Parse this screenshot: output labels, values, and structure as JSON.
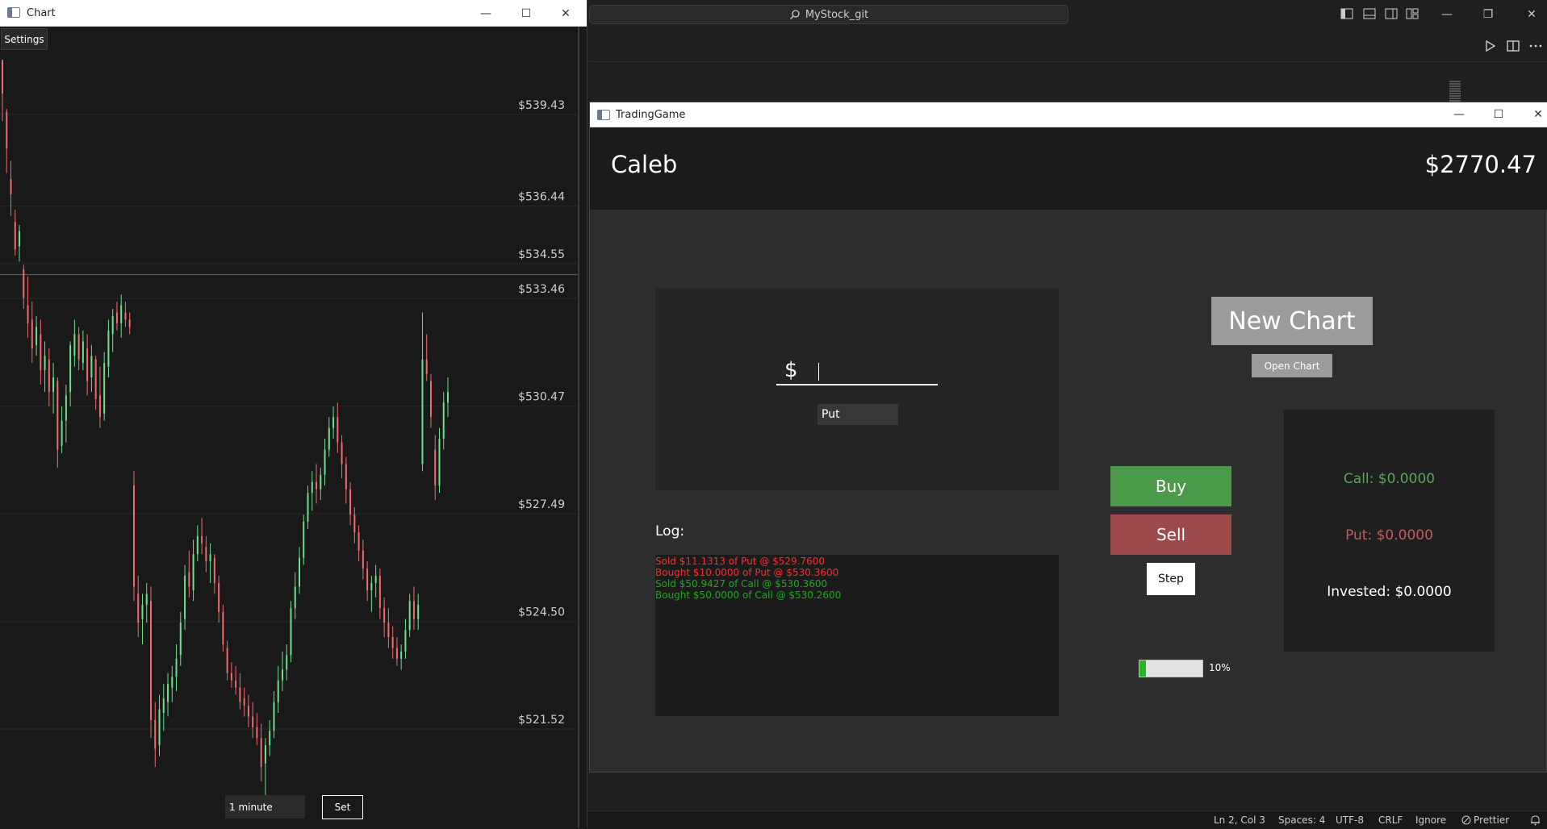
{
  "vscode": {
    "search": "MyStock_git",
    "status_bar": {
      "position": "Ln 2, Col 3",
      "spaces": "Spaces: 4",
      "encoding": "UTF-8",
      "eol": "CRLF",
      "ignore": "Ignore",
      "prettier": "Prettier"
    }
  },
  "chart_window": {
    "title": "Chart",
    "settings_label": "Settings",
    "interval_value": "1 minute",
    "set_label": "Set",
    "price_labels": [
      "$539.43",
      "$536.44",
      "$534.55",
      "$533.46",
      "$530.47",
      "$527.49",
      "$524.50",
      "$521.52"
    ]
  },
  "chart_data": {
    "type": "candlestick",
    "title": "",
    "ytick_labels": [
      "$539.43",
      "$536.44",
      "$534.55",
      "$533.46",
      "$530.47",
      "$527.49",
      "$524.50",
      "$521.52"
    ],
    "ylim": [
      519.0,
      541.0
    ],
    "current_price_line": 534.12,
    "colors": {
      "up": "#6fe08a",
      "down": "#f06b6b"
    },
    "candles": [
      [
        540.9,
        540.4,
        538.9,
        539.8
      ],
      [
        539.2,
        539.3,
        537.2,
        538.0
      ],
      [
        537.0,
        537.6,
        535.8,
        536.5
      ],
      [
        535.6,
        536.0,
        534.5,
        534.7
      ],
      [
        534.8,
        535.5,
        534.3,
        535.3
      ],
      [
        534.0,
        534.2,
        532.9,
        533.2
      ],
      [
        533.0,
        533.8,
        532.1,
        532.5
      ],
      [
        532.6,
        533.1,
        531.4,
        531.8
      ],
      [
        531.9,
        532.7,
        531.6,
        532.4
      ],
      [
        532.2,
        532.6,
        530.8,
        531.2
      ],
      [
        531.2,
        532.0,
        530.6,
        531.6
      ],
      [
        531.5,
        531.8,
        530.2,
        530.6
      ],
      [
        530.6,
        531.4,
        530.0,
        531.0
      ],
      [
        530.9,
        531.0,
        528.5,
        529.0
      ],
      [
        529.1,
        530.2,
        528.9,
        529.8
      ],
      [
        529.8,
        530.8,
        529.2,
        530.5
      ],
      [
        530.6,
        532.0,
        530.2,
        531.9
      ],
      [
        531.6,
        532.6,
        531.3,
        532.2
      ],
      [
        532.2,
        532.4,
        531.2,
        531.5
      ],
      [
        531.4,
        532.3,
        531.2,
        532.0
      ],
      [
        531.8,
        532.2,
        530.5,
        530.9
      ],
      [
        531.0,
        531.9,
        530.6,
        531.6
      ],
      [
        531.5,
        531.6,
        530.1,
        530.4
      ],
      [
        530.5,
        531.3,
        529.6,
        529.9
      ],
      [
        530.0,
        531.7,
        529.8,
        531.4
      ],
      [
        531.3,
        532.6,
        531.0,
        532.3
      ],
      [
        532.2,
        532.9,
        531.7,
        532.7
      ],
      [
        532.8,
        533.1,
        532.3,
        532.5
      ],
      [
        532.5,
        533.3,
        532.1,
        533.0
      ],
      [
        532.8,
        533.1,
        532.4,
        532.6
      ],
      [
        532.6,
        532.8,
        532.2,
        532.4
      ],
      [
        528.0,
        528.4,
        524.8,
        525.2
      ],
      [
        525.0,
        525.5,
        523.8,
        524.2
      ],
      [
        524.3,
        525.0,
        523.6,
        524.7
      ],
      [
        524.7,
        525.3,
        524.2,
        525.0
      ],
      [
        524.8,
        525.2,
        521.0,
        521.5
      ],
      [
        521.5,
        522.0,
        520.2,
        520.7
      ],
      [
        520.8,
        522.2,
        520.5,
        521.8
      ],
      [
        521.7,
        522.5,
        521.2,
        522.1
      ],
      [
        522.0,
        522.8,
        521.6,
        522.5
      ],
      [
        522.4,
        523.0,
        522.0,
        522.7
      ],
      [
        522.7,
        523.6,
        522.3,
        523.2
      ],
      [
        523.3,
        524.5,
        523.0,
        524.2
      ],
      [
        524.3,
        525.8,
        524.0,
        525.5
      ],
      [
        525.6,
        526.2,
        524.9,
        525.2
      ],
      [
        525.1,
        526.5,
        524.8,
        526.1
      ],
      [
        526.1,
        526.9,
        525.9,
        526.6
      ],
      [
        526.6,
        527.1,
        526.1,
        526.4
      ],
      [
        526.3,
        526.6,
        525.6,
        525.9
      ],
      [
        525.9,
        526.4,
        525.3,
        526.1
      ],
      [
        526.0,
        526.1,
        525.0,
        525.3
      ],
      [
        525.3,
        525.5,
        524.2,
        524.5
      ],
      [
        524.5,
        524.7,
        523.4,
        523.6
      ],
      [
        523.5,
        523.7,
        522.6,
        522.8
      ],
      [
        522.8,
        523.1,
        522.4,
        522.6
      ],
      [
        522.6,
        523.0,
        522.2,
        522.4
      ],
      [
        522.4,
        522.8,
        521.8,
        522.0
      ],
      [
        522.1,
        522.4,
        521.6,
        521.9
      ],
      [
        521.9,
        522.2,
        521.3,
        521.6
      ],
      [
        521.6,
        522.0,
        521.0,
        521.3
      ],
      [
        521.3,
        521.7,
        520.8,
        521.0
      ],
      [
        521.0,
        521.4,
        519.8,
        520.2
      ],
      [
        520.3,
        521.0,
        519.3,
        520.8
      ],
      [
        520.8,
        521.5,
        520.5,
        521.2
      ],
      [
        521.2,
        522.3,
        521.0,
        522.0
      ],
      [
        522.0,
        523.0,
        521.7,
        522.6
      ],
      [
        522.6,
        523.4,
        522.3,
        522.9
      ],
      [
        522.9,
        523.6,
        522.6,
        523.3
      ],
      [
        523.3,
        524.8,
        523.1,
        524.6
      ],
      [
        524.6,
        525.6,
        524.3,
        525.2
      ],
      [
        525.2,
        526.3,
        525.0,
        526.0
      ],
      [
        526.0,
        527.2,
        525.8,
        527.0
      ],
      [
        527.0,
        528.0,
        526.8,
        527.8
      ],
      [
        527.8,
        528.4,
        527.3,
        528.1
      ],
      [
        528.1,
        528.6,
        527.5,
        527.9
      ],
      [
        527.9,
        528.5,
        527.6,
        528.3
      ],
      [
        528.3,
        529.3,
        528.0,
        529.0
      ],
      [
        529.0,
        529.9,
        528.8,
        529.6
      ],
      [
        529.6,
        530.2,
        529.3,
        529.9
      ],
      [
        529.9,
        530.3,
        528.9,
        529.2
      ],
      [
        529.2,
        529.4,
        528.2,
        528.6
      ],
      [
        528.6,
        528.8,
        527.5,
        527.9
      ],
      [
        527.9,
        528.1,
        526.9,
        527.2
      ],
      [
        527.2,
        527.4,
        526.4,
        526.7
      ],
      [
        526.7,
        526.9,
        525.9,
        526.2
      ],
      [
        526.2,
        526.5,
        525.4,
        525.7
      ],
      [
        525.7,
        525.9,
        524.8,
        525.1
      ],
      [
        525.1,
        525.5,
        524.5,
        525.3
      ],
      [
        525.3,
        525.8,
        524.9,
        525.5
      ],
      [
        525.5,
        525.7,
        524.3,
        524.6
      ],
      [
        524.6,
        524.9,
        523.8,
        524.2
      ],
      [
        524.2,
        524.6,
        523.5,
        523.8
      ],
      [
        523.8,
        524.1,
        523.2,
        523.5
      ],
      [
        523.5,
        523.8,
        523.0,
        523.2
      ],
      [
        523.2,
        523.6,
        522.9,
        523.4
      ],
      [
        523.4,
        524.3,
        523.2,
        524.0
      ],
      [
        524.0,
        525.0,
        523.8,
        524.8
      ],
      [
        524.8,
        525.2,
        524.0,
        524.3
      ],
      [
        524.3,
        525.0,
        524.0,
        524.7
      ],
      [
        528.6,
        532.8,
        528.4,
        531.5
      ],
      [
        531.5,
        532.2,
        530.9,
        531.1
      ],
      [
        530.9,
        531.1,
        529.6,
        529.9
      ],
      [
        529.0,
        529.4,
        527.6,
        528.0
      ],
      [
        528.0,
        529.6,
        527.8,
        529.3
      ],
      [
        529.3,
        530.6,
        529.0,
        530.3
      ],
      [
        530.3,
        531.0,
        529.9,
        530.6
      ]
    ]
  },
  "game_window": {
    "title": "TradingGame",
    "player_name": "Caleb",
    "balance": "$2770.47",
    "amount_prefix": "$",
    "amount_value": "",
    "option_type": "Put",
    "log_label": "Log:",
    "log_entries": [
      {
        "text": "Sold $11.1313 of Put @ $529.7600",
        "color": "#ff2a2a"
      },
      {
        "text": "Bought $10.0000 of Put @ $530.3600",
        "color": "#ff2a2a"
      },
      {
        "text": "Sold $50.9427 of Call @ $530.3600",
        "color": "#1fa71f"
      },
      {
        "text": "Bought $50.0000 of Call @ $530.2600",
        "color": "#1fa71f"
      }
    ],
    "new_chart_label": "New Chart",
    "open_chart_label": "Open Chart",
    "buy_label": "Buy",
    "sell_label": "Sell",
    "step_label": "Step",
    "progress_percent": 10,
    "progress_label": "10%",
    "call_text": "Call: $0.0000",
    "put_text": "Put: $0.0000",
    "invested_text": "Invested: $0.0000",
    "colors": {
      "buy": "#4a9a4a",
      "sell": "#9c4a4a",
      "call": "#57a657",
      "put": "#c45a5a",
      "progress": "#26b526"
    }
  }
}
